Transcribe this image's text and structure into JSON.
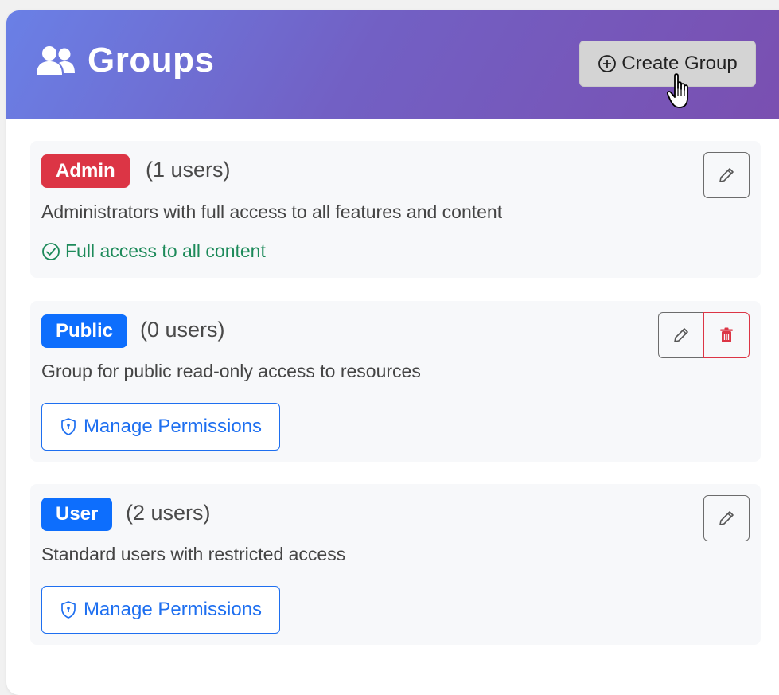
{
  "header": {
    "title": "Groups",
    "create_button_label": "Create Group"
  },
  "colors": {
    "admin_badge": "#dc3545",
    "public_badge": "#0d6efd",
    "user_badge": "#0d6efd",
    "success_text": "#1d8a5a",
    "link_blue": "#1e6ff0",
    "danger": "#dc3545"
  },
  "groups": [
    {
      "name": "Admin",
      "count": "(1 users)",
      "description": "Administrators with full access to all features and content",
      "access_note": "Full access to all content"
    },
    {
      "name": "Public",
      "count": "(0 users)",
      "description": "Group for public read-only access to resources",
      "manage_label": "Manage Permissions"
    },
    {
      "name": "User",
      "count": "(2 users)",
      "description": "Standard users with restricted access",
      "manage_label": "Manage Permissions"
    }
  ],
  "icons": {
    "header": "users-icon",
    "create": "plus-circle-icon",
    "edit": "pencil-icon",
    "delete": "trash-icon",
    "manage": "shield-icon",
    "access": "check-circle-icon",
    "cursor": "hand-pointer-icon"
  }
}
